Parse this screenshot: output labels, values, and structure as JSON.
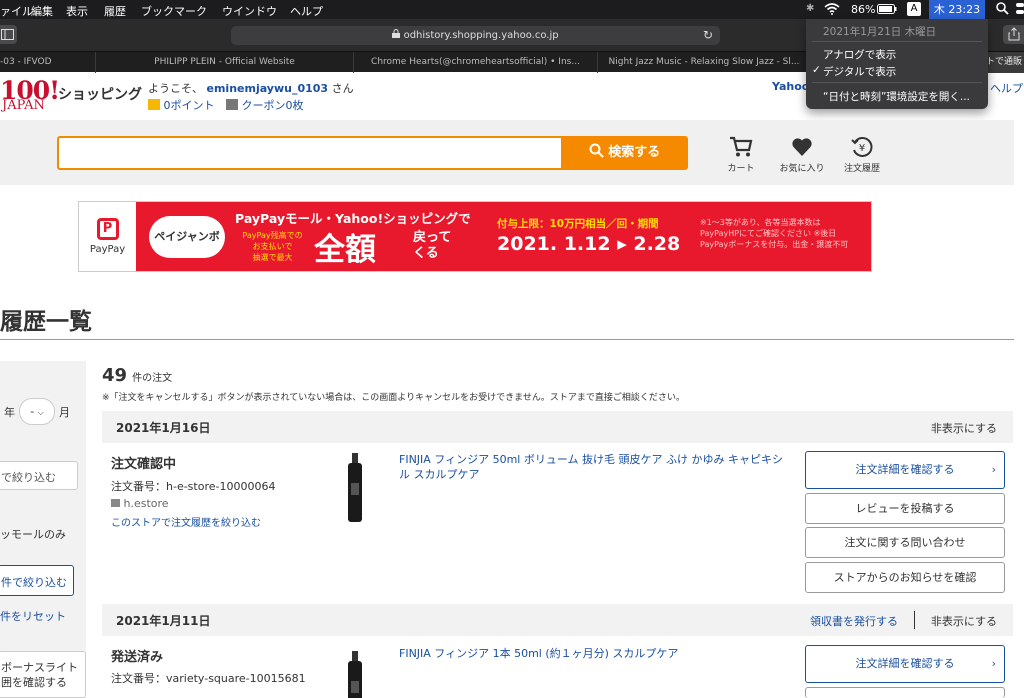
{
  "menubar": {
    "items": [
      "ァイル",
      "編集",
      "表示",
      "履歴",
      "ブックマーク",
      "ウインドウ",
      "ヘルプ"
    ],
    "battery": "86%",
    "input_mode": "A",
    "clock": "木 23:23"
  },
  "browser": {
    "url": "odhistory.shopping.yahoo.co.jp",
    "tabs": [
      "-03 - IFVOD",
      "PHILIPP PLEIN - Official Website",
      "Chrome Hearts(@chromeheartsofficial) • Ins...",
      "Night Jazz Music - Relaxing Slow Jazz - Sl...",
      "トで通販・"
    ]
  },
  "clock_menu": {
    "date": "2021年1月21日 木曜日",
    "analog": "アナログで表示",
    "digital": "デジタルで表示",
    "check": "✓",
    "prefs": "“日付と時刻”環境設定を開く..."
  },
  "header": {
    "logo_top": "100!",
    "logo_bottom": "JAPAN",
    "shopping": "ショッピング",
    "welcome_prefix": "ようこそ、",
    "username": "eminemjaywu_0103",
    "welcome_suffix": "さん",
    "points": "0ポイント",
    "coupons": "クーポン0枚",
    "right_link_1": "Yahoo",
    "right_link_2": "ヘルプ"
  },
  "search": {
    "button": "検索する",
    "cart": "カート",
    "favorites": "お気に入り",
    "history": "注文履歴"
  },
  "banner": {
    "paypay": "PayPay",
    "jumbo": "ペイジャンボ",
    "title": "PayPayモール・Yahoo!ショッピングで",
    "sub1": "PayPay残高での",
    "sub2": "お支払いで",
    "sub3": "抽選で最大",
    "big": "全額",
    "back1": "戻って",
    "back2": "くる",
    "limit": "付与上限：10万円相当／回・期間",
    "dates": "2021. 1.12 ▸ 2.28",
    "note1": "※1〜3等があり、各等当選本数は",
    "note2": "PayPayHPにてご確認ください ※後日",
    "note3": "PayPayボーナスを付与。出金・譲渡不可"
  },
  "page": {
    "title": "履歴一覧",
    "count": "49",
    "count_suffix": "件の注文",
    "notice": "※「注文をキャンセルする」ボタンが表示されていない場合は、この画面よりキャンセルをお受けできません。ストアまで直接ご相談ください。"
  },
  "sidebar": {
    "year_suffix": "年",
    "month_value": "-",
    "month_suffix": "月",
    "filter_input": "で絞り込む",
    "mall_only": "ッモールのみ",
    "filter_btn": "件で絞り込む",
    "reset": "件をリセット",
    "bonus1": "ボーナスライト",
    "bonus2": "囲を確認する"
  },
  "orders": [
    {
      "date": "2021年1月16日",
      "hide": "非表示にする",
      "status": "注文確認中",
      "order_no": "注文番号：h-e-store-10000064",
      "store": "h.estore",
      "store_filter": "このストアで注文履歴を絞り込む",
      "product": "FINJIA フィンジア 50ml ボリューム 抜け毛 頭皮ケア ふけ かゆみ キャピキシル スカルプケア",
      "buttons": [
        "注文詳細を確認する",
        "レビューを投稿する",
        "注文に関する問い合わせ",
        "ストアからのお知らせを確認"
      ]
    },
    {
      "date": "2021年1月11日",
      "receipt": "領収書を発行する",
      "hide": "非表示にする",
      "status": "発送済み",
      "order_no": "注文番号：variety-square-10015681",
      "product": "FINJIA フィンジア 1本 50ml (約１ヶ月分) スカルプケア",
      "buttons": [
        "注文詳細を確認する"
      ]
    }
  ],
  "colors": {
    "accent": "#f58a00",
    "link": "#1a4fa0",
    "banner_red": "#e8192c",
    "logo_red": "#c8102e"
  }
}
